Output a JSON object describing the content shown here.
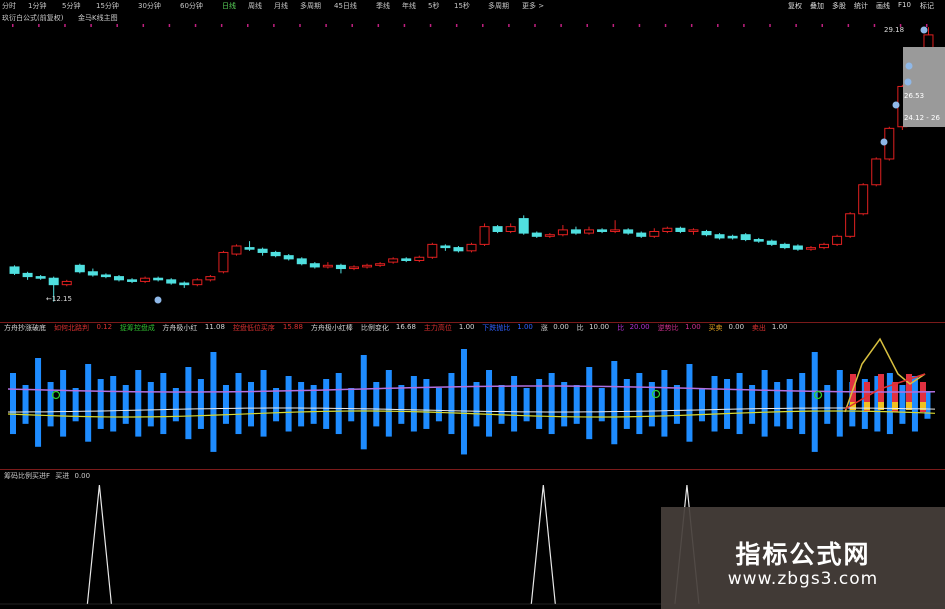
{
  "toolbar": {
    "items": [
      {
        "label": "分时",
        "color": "#c8c8c8"
      },
      {
        "label": "1分钟",
        "color": "#c8c8c8"
      },
      {
        "label": "5分钟",
        "color": "#c8c8c8"
      },
      {
        "label": "15分钟",
        "color": "#c8c8c8"
      },
      {
        "label": "30分钟",
        "color": "#c8c8c8"
      },
      {
        "label": "60分钟",
        "color": "#c8c8c8"
      },
      {
        "label": "日线",
        "color": "#5ad45a"
      },
      {
        "label": "周线",
        "color": "#c8c8c8"
      },
      {
        "label": "月线",
        "color": "#c8c8c8"
      },
      {
        "label": "多周期",
        "color": "#c8c8c8"
      },
      {
        "label": "45日线",
        "color": "#c8c8c8"
      },
      {
        "label": "季线",
        "color": "#c8c8c8"
      },
      {
        "label": "年线",
        "color": "#c8c8c8"
      },
      {
        "label": "5秒",
        "color": "#c8c8c8"
      },
      {
        "label": "15秒",
        "color": "#c8c8c8"
      },
      {
        "label": "多周期",
        "color": "#c8c8c8"
      },
      {
        "label": "更多 >",
        "color": "#c8c8c8"
      }
    ],
    "right_items": [
      "复权",
      "叠加",
      "多股",
      "统计",
      "画线",
      "F10",
      "标记"
    ]
  },
  "price_header": {
    "main_label": "玖衍白公式(前复权)",
    "secondary_label": "金马K线主图"
  },
  "price_chart": {
    "high_label": "29.18",
    "low_label": "12.15",
    "annotations": [
      "26.53",
      "24.12 - 26"
    ],
    "candles": [
      {
        "o": 14.3,
        "c": 13.9,
        "h": 14.4,
        "l": 13.8
      },
      {
        "o": 13.9,
        "c": 13.7,
        "h": 14.0,
        "l": 13.5
      },
      {
        "o": 13.7,
        "c": 13.6,
        "h": 13.8,
        "l": 13.5
      },
      {
        "o": 13.6,
        "c": 13.2,
        "h": 13.7,
        "l": 12.15
      },
      {
        "o": 13.2,
        "c": 13.4,
        "h": 13.5,
        "l": 13.1
      },
      {
        "o": 14.4,
        "c": 14.0,
        "h": 14.5,
        "l": 13.9
      },
      {
        "o": 14.0,
        "c": 13.8,
        "h": 14.2,
        "l": 13.7
      },
      {
        "o": 13.8,
        "c": 13.7,
        "h": 13.9,
        "l": 13.6
      },
      {
        "o": 13.7,
        "c": 13.5,
        "h": 13.8,
        "l": 13.4
      },
      {
        "o": 13.5,
        "c": 13.4,
        "h": 13.6,
        "l": 13.3
      },
      {
        "o": 13.4,
        "c": 13.6,
        "h": 13.7,
        "l": 13.3
      },
      {
        "o": 13.6,
        "c": 13.5,
        "h": 13.7,
        "l": 13.4
      },
      {
        "o": 13.5,
        "c": 13.3,
        "h": 13.6,
        "l": 13.2
      },
      {
        "o": 13.3,
        "c": 13.2,
        "h": 13.4,
        "l": 13.0
      },
      {
        "o": 13.2,
        "c": 13.5,
        "h": 13.6,
        "l": 13.1
      },
      {
        "o": 13.5,
        "c": 13.7,
        "h": 13.8,
        "l": 13.4
      },
      {
        "o": 14.0,
        "c": 15.2,
        "h": 15.3,
        "l": 13.9
      },
      {
        "o": 15.1,
        "c": 15.6,
        "h": 15.7,
        "l": 15.0
      },
      {
        "o": 15.5,
        "c": 15.4,
        "h": 15.9,
        "l": 15.3
      },
      {
        "o": 15.4,
        "c": 15.2,
        "h": 15.5,
        "l": 15.0
      },
      {
        "o": 15.2,
        "c": 15.0,
        "h": 15.3,
        "l": 14.9
      },
      {
        "o": 15.0,
        "c": 14.8,
        "h": 15.1,
        "l": 14.7
      },
      {
        "o": 14.8,
        "c": 14.5,
        "h": 14.9,
        "l": 14.4
      },
      {
        "o": 14.5,
        "c": 14.3,
        "h": 14.6,
        "l": 14.2
      },
      {
        "o": 14.3,
        "c": 14.4,
        "h": 14.6,
        "l": 14.2
      },
      {
        "o": 14.4,
        "c": 14.2,
        "h": 14.5,
        "l": 13.9
      },
      {
        "o": 14.2,
        "c": 14.3,
        "h": 14.4,
        "l": 14.1
      },
      {
        "o": 14.3,
        "c": 14.4,
        "h": 14.5,
        "l": 14.2
      },
      {
        "o": 14.4,
        "c": 14.5,
        "h": 14.6,
        "l": 14.3
      },
      {
        "o": 14.6,
        "c": 14.8,
        "h": 14.9,
        "l": 14.5
      },
      {
        "o": 14.8,
        "c": 14.7,
        "h": 14.9,
        "l": 14.6
      },
      {
        "o": 14.7,
        "c": 14.9,
        "h": 15.0,
        "l": 14.6
      },
      {
        "o": 14.9,
        "c": 15.7,
        "h": 15.8,
        "l": 14.8
      },
      {
        "o": 15.6,
        "c": 15.5,
        "h": 15.7,
        "l": 15.3
      },
      {
        "o": 15.5,
        "c": 15.3,
        "h": 15.6,
        "l": 15.2
      },
      {
        "o": 15.3,
        "c": 15.7,
        "h": 15.8,
        "l": 15.2
      },
      {
        "o": 15.7,
        "c": 16.8,
        "h": 17.0,
        "l": 15.6
      },
      {
        "o": 16.8,
        "c": 16.5,
        "h": 16.9,
        "l": 16.4
      },
      {
        "o": 16.5,
        "c": 16.8,
        "h": 17.0,
        "l": 16.4
      },
      {
        "o": 17.3,
        "c": 16.4,
        "h": 17.5,
        "l": 16.3
      },
      {
        "o": 16.4,
        "c": 16.2,
        "h": 16.5,
        "l": 16.1
      },
      {
        "o": 16.2,
        "c": 16.3,
        "h": 16.4,
        "l": 16.1
      },
      {
        "o": 16.3,
        "c": 16.6,
        "h": 16.9,
        "l": 16.2
      },
      {
        "o": 16.6,
        "c": 16.4,
        "h": 16.8,
        "l": 16.3
      },
      {
        "o": 16.4,
        "c": 16.6,
        "h": 16.8,
        "l": 16.3
      },
      {
        "o": 16.6,
        "c": 16.5,
        "h": 16.7,
        "l": 16.4
      },
      {
        "o": 16.5,
        "c": 16.6,
        "h": 17.2,
        "l": 16.4
      },
      {
        "o": 16.6,
        "c": 16.4,
        "h": 16.7,
        "l": 16.3
      },
      {
        "o": 16.4,
        "c": 16.2,
        "h": 16.5,
        "l": 16.1
      },
      {
        "o": 16.2,
        "c": 16.5,
        "h": 16.7,
        "l": 16.1
      },
      {
        "o": 16.5,
        "c": 16.7,
        "h": 16.8,
        "l": 16.4
      },
      {
        "o": 16.7,
        "c": 16.5,
        "h": 16.8,
        "l": 16.4
      },
      {
        "o": 16.5,
        "c": 16.6,
        "h": 16.7,
        "l": 16.3
      },
      {
        "o": 16.5,
        "c": 16.3,
        "h": 16.6,
        "l": 16.2
      },
      {
        "o": 16.3,
        "c": 16.1,
        "h": 16.4,
        "l": 16.0
      },
      {
        "o": 16.2,
        "c": 16.1,
        "h": 16.3,
        "l": 16.0
      },
      {
        "o": 16.3,
        "c": 16.0,
        "h": 16.4,
        "l": 15.9
      },
      {
        "o": 16.0,
        "c": 15.9,
        "h": 16.1,
        "l": 15.8
      },
      {
        "o": 15.9,
        "c": 15.7,
        "h": 16.0,
        "l": 15.6
      },
      {
        "o": 15.7,
        "c": 15.5,
        "h": 15.8,
        "l": 15.4
      },
      {
        "o": 15.6,
        "c": 15.4,
        "h": 15.7,
        "l": 15.3
      },
      {
        "o": 15.4,
        "c": 15.5,
        "h": 15.6,
        "l": 15.3
      },
      {
        "o": 15.5,
        "c": 15.7,
        "h": 15.8,
        "l": 15.4
      },
      {
        "o": 15.7,
        "c": 16.2,
        "h": 16.3,
        "l": 15.6
      },
      {
        "o": 16.2,
        "c": 17.6,
        "h": 17.7,
        "l": 16.1
      },
      {
        "o": 17.6,
        "c": 19.4,
        "h": 19.5,
        "l": 17.5
      },
      {
        "o": 19.4,
        "c": 21.0,
        "h": 21.1,
        "l": 19.3
      },
      {
        "o": 21.0,
        "c": 22.9,
        "h": 23.0,
        "l": 20.9
      },
      {
        "o": 23.0,
        "c": 25.5,
        "h": 25.6,
        "l": 22.8
      },
      {
        "o": 25.6,
        "c": 27.4,
        "h": 27.5,
        "l": 25.4
      },
      {
        "o": 27.6,
        "c": 28.7,
        "h": 29.18,
        "l": 27.4
      }
    ]
  },
  "indicator1": {
    "labels": [
      {
        "text": "方舟抄涨破底",
        "color": "#d8d8d8"
      },
      {
        "text": "如何北路判",
        "color": "#d83030"
      },
      {
        "text": "0.12",
        "color": "#d83030"
      },
      {
        "text": "捉筹控盘成",
        "color": "#30c030"
      },
      {
        "text": "方舟极小红",
        "color": "#d8d8d8"
      },
      {
        "text": "11.08",
        "color": "#d8d8d8"
      },
      {
        "text": "控盘低位买序",
        "color": "#d83030"
      },
      {
        "text": "15.88",
        "color": "#d83030"
      },
      {
        "text": "方舟极小红棒",
        "color": "#d8d8d8"
      },
      {
        "text": "比例变化",
        "color": "#d8d8d8"
      },
      {
        "text": "16.68",
        "color": "#d8d8d8"
      },
      {
        "text": "主力高位",
        "color": "#d83030"
      },
      {
        "text": "1.00",
        "color": "#d8d8d8"
      },
      {
        "text": "下跌抛比",
        "color": "#3060ff"
      },
      {
        "text": "1.00",
        "color": "#3060ff"
      },
      {
        "text": "涨",
        "color": "#d8d8d8"
      },
      {
        "text": "0.00",
        "color": "#d8d8d8"
      },
      {
        "text": "比",
        "color": "#d8d8d8"
      },
      {
        "text": "10.00",
        "color": "#d8d8d8"
      },
      {
        "text": "比",
        "color": "#b030d0"
      },
      {
        "text": "20.00",
        "color": "#b030d0"
      },
      {
        "text": "逆势比",
        "color": "#d03090"
      },
      {
        "text": "1.00",
        "color": "#d03090"
      },
      {
        "text": "买卖",
        "color": "#e0a020"
      },
      {
        "text": "0.00",
        "color": "#d8d8d8"
      },
      {
        "text": "卖出",
        "color": "#d83030"
      },
      {
        "text": "1.00",
        "color": "#d8d8d8"
      }
    ],
    "bars": [
      0.55,
      0.35,
      0.8,
      0.4,
      0.6,
      0.3,
      0.7,
      0.45,
      0.5,
      0.35,
      0.6,
      0.4,
      0.55,
      0.3,
      0.65,
      0.45,
      0.9,
      0.35,
      0.55,
      0.4,
      0.6,
      0.3,
      0.5,
      0.4,
      0.35,
      0.45,
      0.55,
      0.3,
      0.85,
      0.4,
      0.6,
      0.35,
      0.5,
      0.45,
      0.3,
      0.55,
      0.95,
      0.4,
      0.6,
      0.35,
      0.5,
      0.3,
      0.45,
      0.55,
      0.4,
      0.35,
      0.65,
      0.3,
      0.75,
      0.45,
      0.55,
      0.4,
      0.6,
      0.35,
      0.7,
      0.3,
      0.5,
      0.45,
      0.55,
      0.35,
      0.6,
      0.4,
      0.45,
      0.55,
      0.9,
      0.35,
      0.6,
      0.4,
      0.45,
      0.5,
      0.55,
      0.35,
      0.5,
      0.25
    ]
  },
  "indicator2": {
    "label": "筹码比例买进F",
    "label2": "买进",
    "value": "0.00",
    "spikes": [
      7,
      41,
      52
    ]
  },
  "watermark": {
    "title": "指标公式网",
    "url": "www.zbgs3.com"
  },
  "colors": {
    "up": "#e02020",
    "down": "#50e0e0",
    "bar_blue": "#1e8cff",
    "grid": "#7a1a1a"
  }
}
